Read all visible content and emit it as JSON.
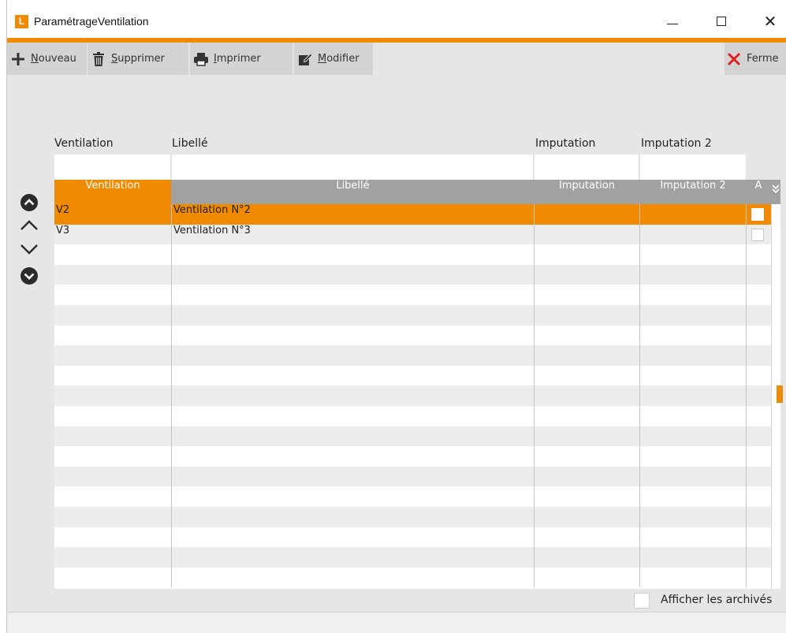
{
  "window": {
    "title": "ParamétrageVentilation",
    "logo_letter": "L",
    "controls": {
      "minimize": "—",
      "maximize": "☐",
      "close": "✕"
    }
  },
  "colors": {
    "accent": "#f08a00",
    "header_gray": "#a1a1a1",
    "toolbar_button": "#d3d3d3",
    "background": "#e6e6e6",
    "close_icon_red": "#e02020"
  },
  "toolbar": {
    "new_label": "Nouveau",
    "new_icon": "plus-icon",
    "delete_label": "Supprimer",
    "delete_icon": "trash-icon",
    "print_label": "Imprimer",
    "print_icon": "printer-icon",
    "edit_label": "Modifier",
    "edit_icon": "edit-icon",
    "close_label": "Ferme",
    "close_icon": "close-x-icon"
  },
  "filters": {
    "ventilation_label": "Ventilation",
    "libelle_label": "Libellé",
    "imputation_label": "Imputation",
    "imputation2_label": "Imputation 2",
    "ventilation_value": "",
    "libelle_value": "",
    "imputation_value": "",
    "imputation2_value": ""
  },
  "grid": {
    "columns": {
      "ventilation": "Ventilation",
      "libelle": "Libellé",
      "imputation": "Imputation",
      "imputation2": "Imputation 2",
      "archived": "A",
      "expand_icon": "double-chevron-down-icon"
    },
    "sorted_column": "ventilation",
    "rows": [
      {
        "ventilation": "V2",
        "libelle": "Ventilation N°2",
        "imputation": "",
        "imputation2": "",
        "archived": false,
        "selected": true
      },
      {
        "ventilation": "V3",
        "libelle": "Ventilation N°3",
        "imputation": "",
        "imputation2": "",
        "archived": false,
        "selected": false
      }
    ],
    "empty_row_count": 17
  },
  "navigation": {
    "first_icon": "circle-chevron-up-icon",
    "previous_icon": "chevron-up-icon",
    "next_icon": "chevron-down-icon",
    "last_icon": "circle-chevron-down-icon"
  },
  "footer": {
    "show_archived_label": "Afficher les archivés",
    "show_archived_checked": false
  }
}
